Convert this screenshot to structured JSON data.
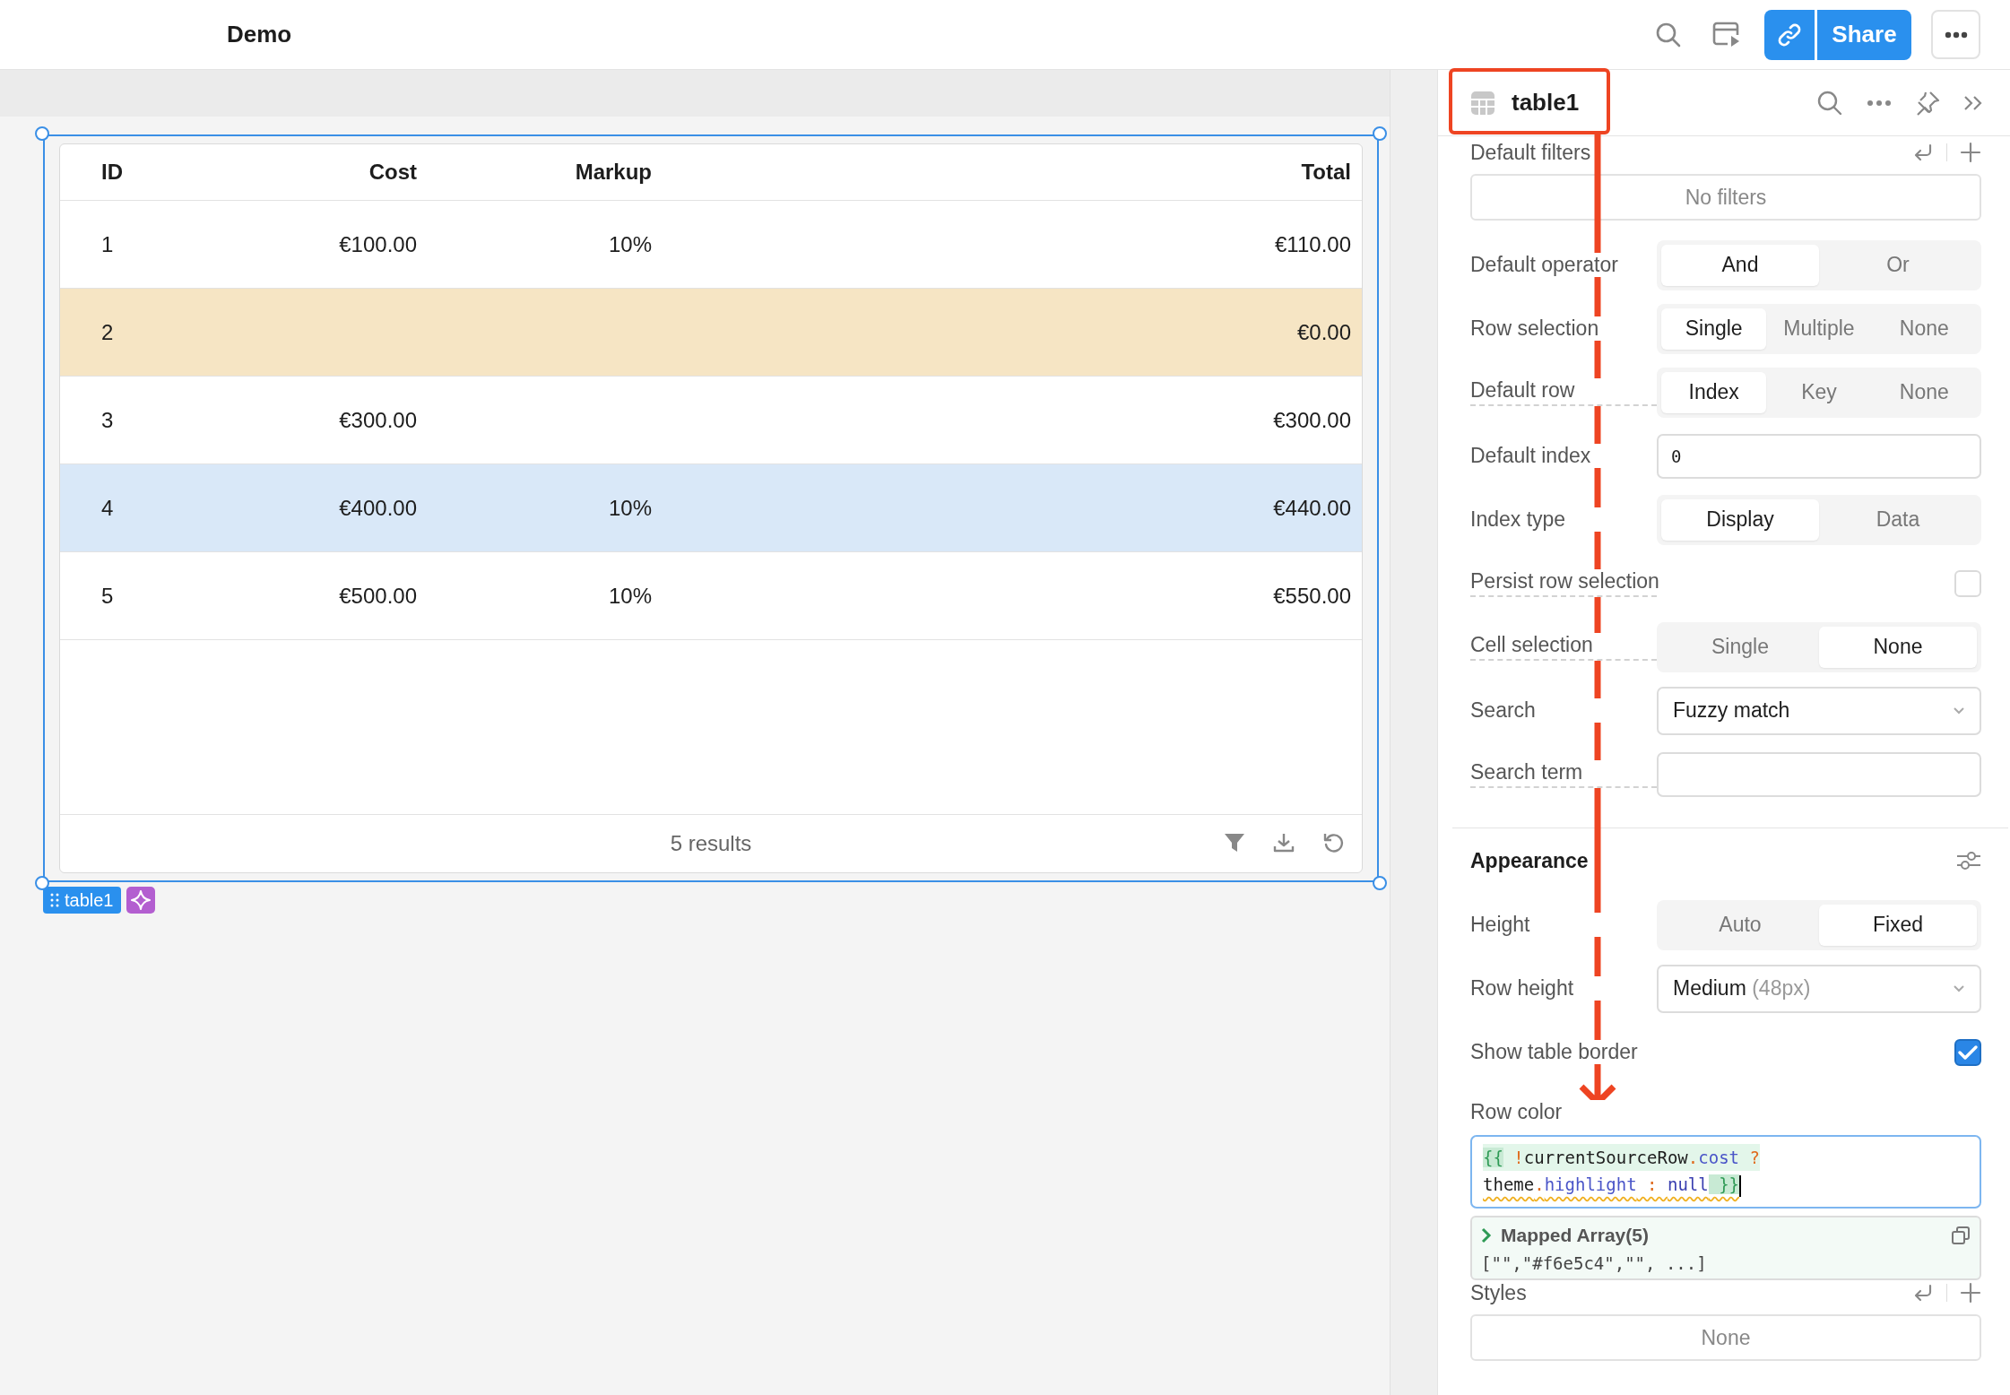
{
  "topbar": {
    "title": "Demo",
    "share_label": "Share"
  },
  "table": {
    "name": "table1",
    "columns": [
      "ID",
      "Cost",
      "Markup",
      "Total"
    ],
    "rows": [
      {
        "cells": [
          "1",
          "€100.00",
          "10%",
          "€110.00"
        ],
        "highlighted": false,
        "selected": false
      },
      {
        "cells": [
          "2",
          "",
          "",
          "€0.00"
        ],
        "highlighted": true,
        "selected": false
      },
      {
        "cells": [
          "3",
          "€300.00",
          "",
          "€300.00"
        ],
        "highlighted": false,
        "selected": false
      },
      {
        "cells": [
          "4",
          "€400.00",
          "10%",
          "€440.00"
        ],
        "highlighted": false,
        "selected": true
      },
      {
        "cells": [
          "5",
          "€500.00",
          "10%",
          "€550.00"
        ],
        "highlighted": false,
        "selected": false
      }
    ],
    "footer": "5 results"
  },
  "panel": {
    "title": "table1",
    "interaction": [
      {
        "kind": "filters",
        "label": "Default filters",
        "hint": false,
        "value": "No filters"
      },
      {
        "kind": "segmented",
        "label": "Default operator",
        "hint": false,
        "options": [
          {
            "label": "And",
            "selected": true
          },
          {
            "label": "Or",
            "selected": false
          }
        ]
      },
      {
        "kind": "segmented",
        "label": "Row selection",
        "hint": false,
        "options": [
          {
            "label": "Single",
            "selected": true
          },
          {
            "label": "Multiple",
            "selected": false
          },
          {
            "label": "None",
            "selected": false
          }
        ]
      },
      {
        "kind": "segmented",
        "label": "Default row",
        "hint": true,
        "options": [
          {
            "label": "Index",
            "selected": true
          },
          {
            "label": "Key",
            "selected": false
          },
          {
            "label": "None",
            "selected": false
          }
        ]
      },
      {
        "kind": "input",
        "label": "Default index",
        "hint": false,
        "value": "0"
      },
      {
        "kind": "segmented",
        "label": "Index type",
        "hint": false,
        "options": [
          {
            "label": "Display",
            "selected": true
          },
          {
            "label": "Data",
            "selected": false
          }
        ]
      },
      {
        "kind": "checkbox",
        "label": "Persist row selection",
        "hint": true,
        "checked": false
      },
      {
        "kind": "segmented",
        "label": "Cell selection",
        "hint": true,
        "options": [
          {
            "label": "Single",
            "selected": false
          },
          {
            "label": "None",
            "selected": true
          }
        ]
      },
      {
        "kind": "select",
        "label": "Search",
        "hint": false,
        "value": "Fuzzy match"
      },
      {
        "kind": "input",
        "label": "Search term",
        "hint": true
      }
    ],
    "appearance": {
      "title": "Appearance",
      "items": [
        {
          "kind": "segmented",
          "label": "Height",
          "hint": false,
          "options": [
            {
              "label": "Auto",
              "selected": false
            },
            {
              "label": "Fixed",
              "selected": true
            }
          ]
        },
        {
          "kind": "select",
          "label": "Row height",
          "hint": false,
          "value": "Medium",
          "detail": "(48px)"
        },
        {
          "kind": "checkbox",
          "label": "Show table border",
          "hint": false,
          "checked": true
        },
        {
          "kind": "code",
          "label": "Row color",
          "hint": false,
          "lines": [
            [
              {
                "text": "{{",
                "kind": "brace"
              },
              {
                "text": " !",
                "kind": "operator"
              },
              {
                "text": "currentSourceRow",
                "kind": "identifier"
              },
              {
                "text": ".",
                "kind": "operator"
              },
              {
                "text": "cost",
                "kind": "property"
              },
              {
                "text": " ?",
                "kind": "operator"
              }
            ],
            [
              {
                "text": "theme",
                "kind": "identifier"
              },
              {
                "text": ".",
                "kind": "operator"
              },
              {
                "text": "highlight",
                "kind": "property"
              },
              {
                "text": " : ",
                "kind": "operator"
              },
              {
                "text": "null",
                "kind": "keyword"
              },
              {
                "text": " }}",
                "kind": "brace"
              }
            ]
          ],
          "result_title": "Mapped Array(5)",
          "result_value": "[\"\",\"#f6e5c4\",\"\", ...]"
        },
        {
          "kind": "filters",
          "label": "Styles",
          "hint": false,
          "value": "None"
        }
      ]
    }
  }
}
